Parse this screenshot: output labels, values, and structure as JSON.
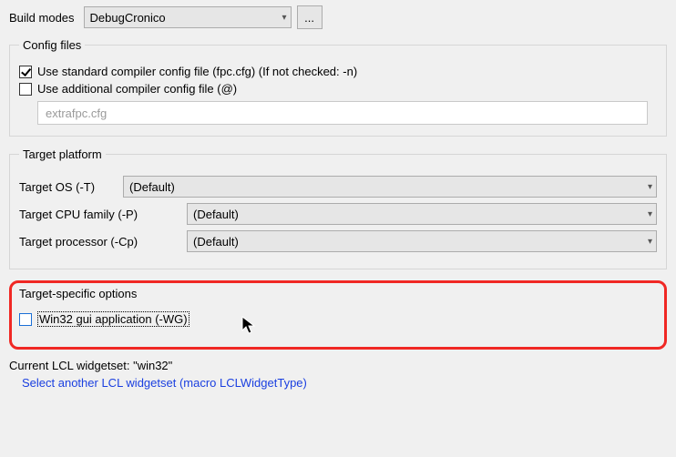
{
  "build_modes": {
    "label": "Build modes",
    "selected": "DebugCronico",
    "more_button": "..."
  },
  "config_files": {
    "legend": "Config files",
    "use_standard": {
      "checked": true,
      "label": "Use standard compiler config file (fpc.cfg) (If not checked: -n)"
    },
    "use_additional": {
      "checked": false,
      "label": "Use additional compiler config file (@)"
    },
    "additional_path": "extrafpc.cfg"
  },
  "target_platform": {
    "legend": "Target platform",
    "os": {
      "label": "Target OS (-T)",
      "value": "(Default)"
    },
    "cpu": {
      "label": "Target CPU family (-P)",
      "value": "(Default)"
    },
    "proc": {
      "label": "Target processor (-Cp)",
      "value": "(Default)"
    }
  },
  "target_specific": {
    "legend": "Target-specific options",
    "win32_gui": {
      "checked": false,
      "label": "Win32 gui application (-WG)"
    }
  },
  "footer": {
    "current_widgetset": "Current LCL widgetset: \"win32\"",
    "link": "Select another LCL widgetset (macro LCLWidgetType)"
  }
}
